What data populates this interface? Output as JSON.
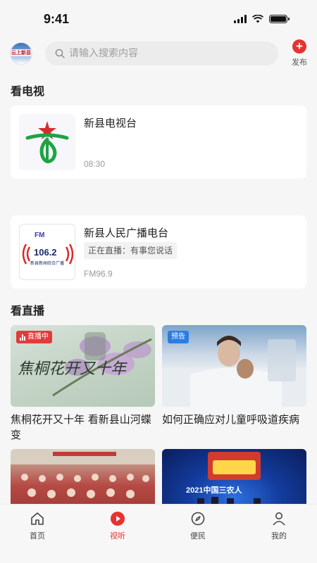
{
  "status": {
    "time": "9:41"
  },
  "header": {
    "logo_text": "云上新县",
    "search_placeholder": "请输入搜索内容",
    "publish_label": "发布"
  },
  "tv_section": {
    "title": "看电视",
    "channels": [
      {
        "name": "新县电视台",
        "time": "08:30"
      }
    ]
  },
  "radio_section": {
    "stations": [
      {
        "name": "新县人民广播电台",
        "live_text": "正在直播：有事您说话",
        "frequency": "FM96.9",
        "logo_fm": "FM",
        "logo_freq": "106.2",
        "logo_caption": "新县新闻综合广播"
      }
    ]
  },
  "live_section": {
    "title": "看直播",
    "videos": [
      {
        "badge": "直播中",
        "title": "焦桐花开又十年 看新县山河蝶变",
        "thumb_caption": "焦桐花开又十年"
      },
      {
        "badge": "预告",
        "title": "如何正确应对儿童呼吸道疾病"
      },
      {
        "badge": "",
        "title": ""
      },
      {
        "badge": "",
        "title": "",
        "thumb_caption": "2021中国三农人"
      }
    ]
  },
  "tab_bar": {
    "tabs": [
      {
        "label": "首页",
        "icon": "home-icon",
        "active": false
      },
      {
        "label": "视听",
        "icon": "play-icon",
        "active": true
      },
      {
        "label": "便民",
        "icon": "compass-icon",
        "active": false
      },
      {
        "label": "我的",
        "icon": "user-icon",
        "active": false
      }
    ]
  },
  "colors": {
    "accent": "#e8322f",
    "live_badge": "#e33b3b",
    "preview_badge": "#2d7de0",
    "background": "#f6f6f6"
  }
}
